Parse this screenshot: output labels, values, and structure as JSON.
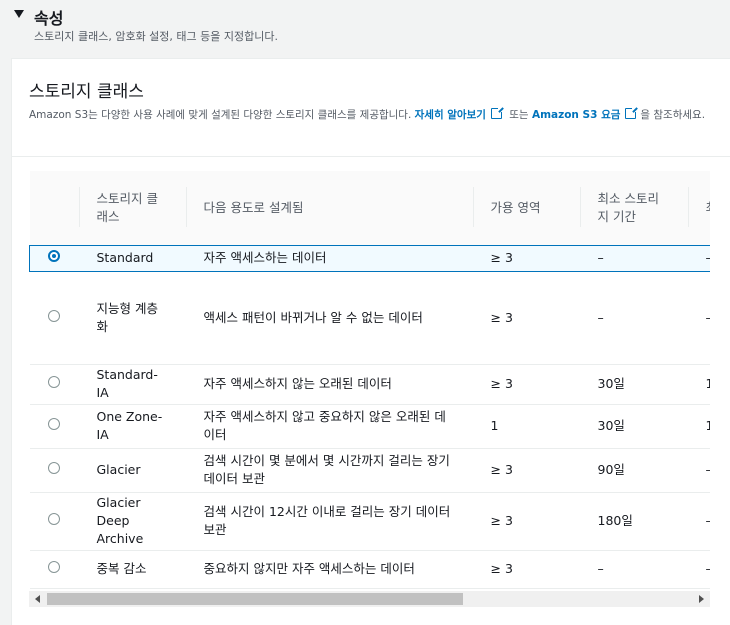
{
  "section": {
    "title": "속성",
    "description": "스토리지 클래스, 암호화 설정, 태그 등을 지정합니다."
  },
  "panel": {
    "title": "스토리지 클래스",
    "desc_prefix": "Amazon S3는 다양한 사용 사례에 맞게 설계된 다양한 스토리지 클래스를 제공합니다.",
    "learn_more_link": "자세히 알아보기",
    "desc_middle": "또는",
    "pricing_link": "Amazon S3 요금",
    "desc_suffix": "을 참조하세요."
  },
  "table": {
    "headers": [
      "",
      "스토리지 클래스",
      "다음 용도로 설계됨",
      "가용 영역",
      "최소 스토리지 기간",
      "최"
    ],
    "rows": [
      {
        "selected": true,
        "class": "Standard",
        "designed_for": "자주 액세스하는 데이터",
        "az": "≥ 3",
        "min_duration": "–",
        "extra": "–"
      },
      {
        "selected": false,
        "class": "지능형 계층화",
        "designed_for": "액세스 패턴이 바뀌거나 알 수 없는 데이터",
        "az": "≥ 3",
        "min_duration": "–",
        "extra": "–"
      },
      {
        "selected": false,
        "class": "Standard-IA",
        "designed_for": "자주 액세스하지 않는 오래된 데이터",
        "az": "≥ 3",
        "min_duration": "30일",
        "extra": "1"
      },
      {
        "selected": false,
        "class": "One Zone-IA",
        "designed_for": "자주 액세스하지 않고 중요하지 않은 오래된 데이터",
        "az": "1",
        "min_duration": "30일",
        "extra": "1"
      },
      {
        "selected": false,
        "class": "Glacier",
        "designed_for": "검색 시간이 몇 분에서 몇 시간까지 걸리는 장기 데이터 보관",
        "az": "≥ 3",
        "min_duration": "90일",
        "extra": "–"
      },
      {
        "selected": false,
        "class": "Glacier Deep Archive",
        "designed_for": "검색 시간이 12시간 이내로 걸리는 장기 데이터 보관",
        "az": "≥ 3",
        "min_duration": "180일",
        "extra": "–"
      },
      {
        "selected": false,
        "class": "중복 감소",
        "designed_for": "중요하지 않지만 자주 액세스하는 데이터",
        "az": "≥ 3",
        "min_duration": "–",
        "extra": "–"
      }
    ]
  },
  "scroll": {
    "horizontal_position": 0.0
  }
}
